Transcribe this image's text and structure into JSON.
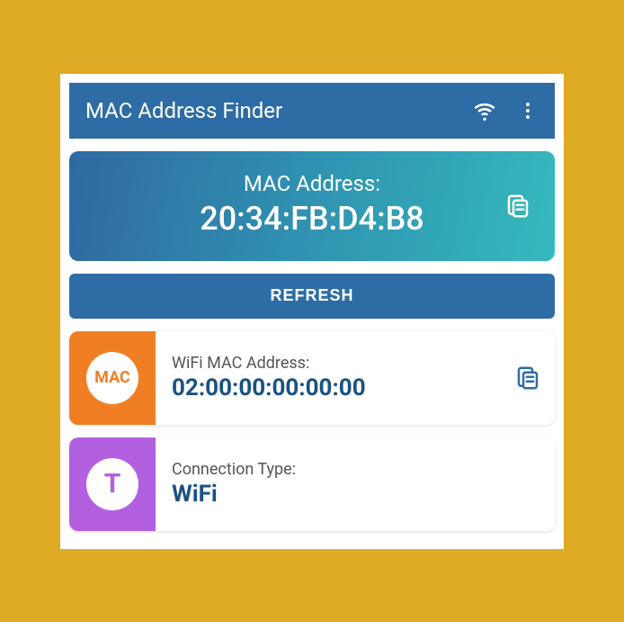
{
  "appbar": {
    "title": "MAC Address Finder"
  },
  "hero": {
    "label": "MAC Address:",
    "value": "20:34:FB:D4:B8"
  },
  "refresh": {
    "label": "REFRESH"
  },
  "wifi_card": {
    "icon_text": "MAC",
    "label": "WiFi MAC Address:",
    "value": "02:00:00:00:00:00"
  },
  "conn_card": {
    "icon_text": "T",
    "label": "Connection Type:",
    "value": "WiFi"
  }
}
